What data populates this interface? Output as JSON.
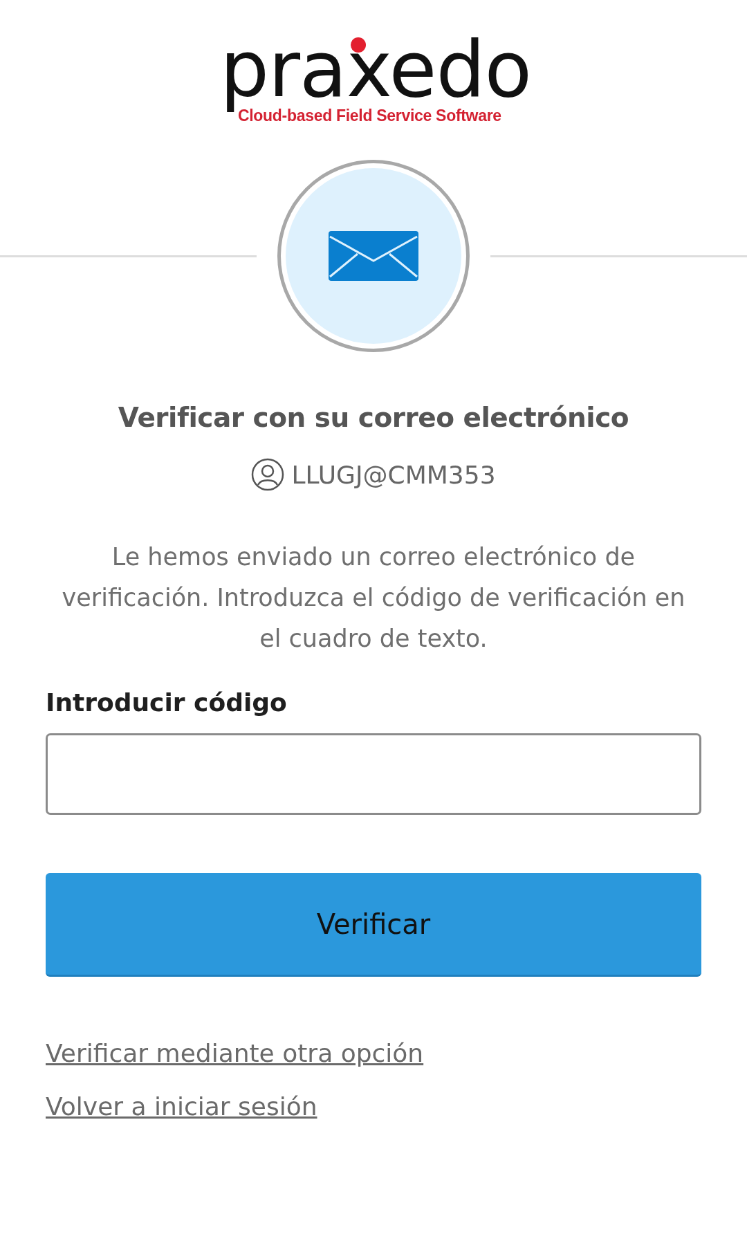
{
  "logo": {
    "wordmark": "praxedo",
    "tagline": "Cloud-based Field Service Software"
  },
  "title": "Verificar con su correo electrónico",
  "username": "LLUGJ@CMM353",
  "message": "Le hemos enviado un correo electrónico de verificación. Introduzca el código de verificación en el cuadro de texto.",
  "code_field": {
    "label": "Introducir código"
  },
  "submit_button": "Verificar",
  "links": [
    "Verificar mediante otra opción",
    "Volver a iniciar sesión"
  ]
}
